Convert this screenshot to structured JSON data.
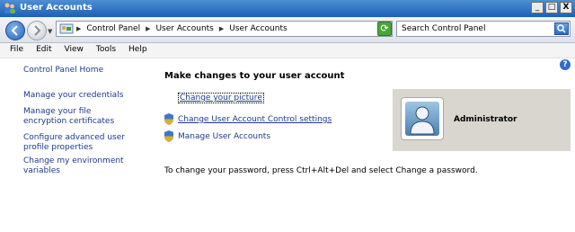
{
  "window": {
    "title": "User Accounts",
    "controls": {
      "minimize": "_",
      "maximize": "□",
      "close": "X"
    }
  },
  "nav": {
    "breadcrumbs": [
      "Control Panel",
      "User Accounts",
      "User Accounts"
    ],
    "search_placeholder": "Search Control Panel"
  },
  "menu": {
    "items": [
      "File",
      "Edit",
      "View",
      "Tools",
      "Help"
    ]
  },
  "sidebar": {
    "items": [
      "Control Panel Home",
      "Manage your credentials",
      "Manage your file encryption certificates",
      "Configure advanced user profile properties",
      "Change my environment variables"
    ]
  },
  "main": {
    "title": "Make changes to your user account",
    "tasks": [
      "Change your picture",
      "Change User Account Control settings",
      "Manage User Accounts"
    ],
    "password_note": "To change your password, press Ctrl+Alt+Del and select Change a password."
  },
  "user": {
    "name": "Administrator"
  },
  "colors": {
    "link": "#1e3a8a",
    "titlebar": "#1c5fb6",
    "user_panel": "#d8d6cf"
  }
}
